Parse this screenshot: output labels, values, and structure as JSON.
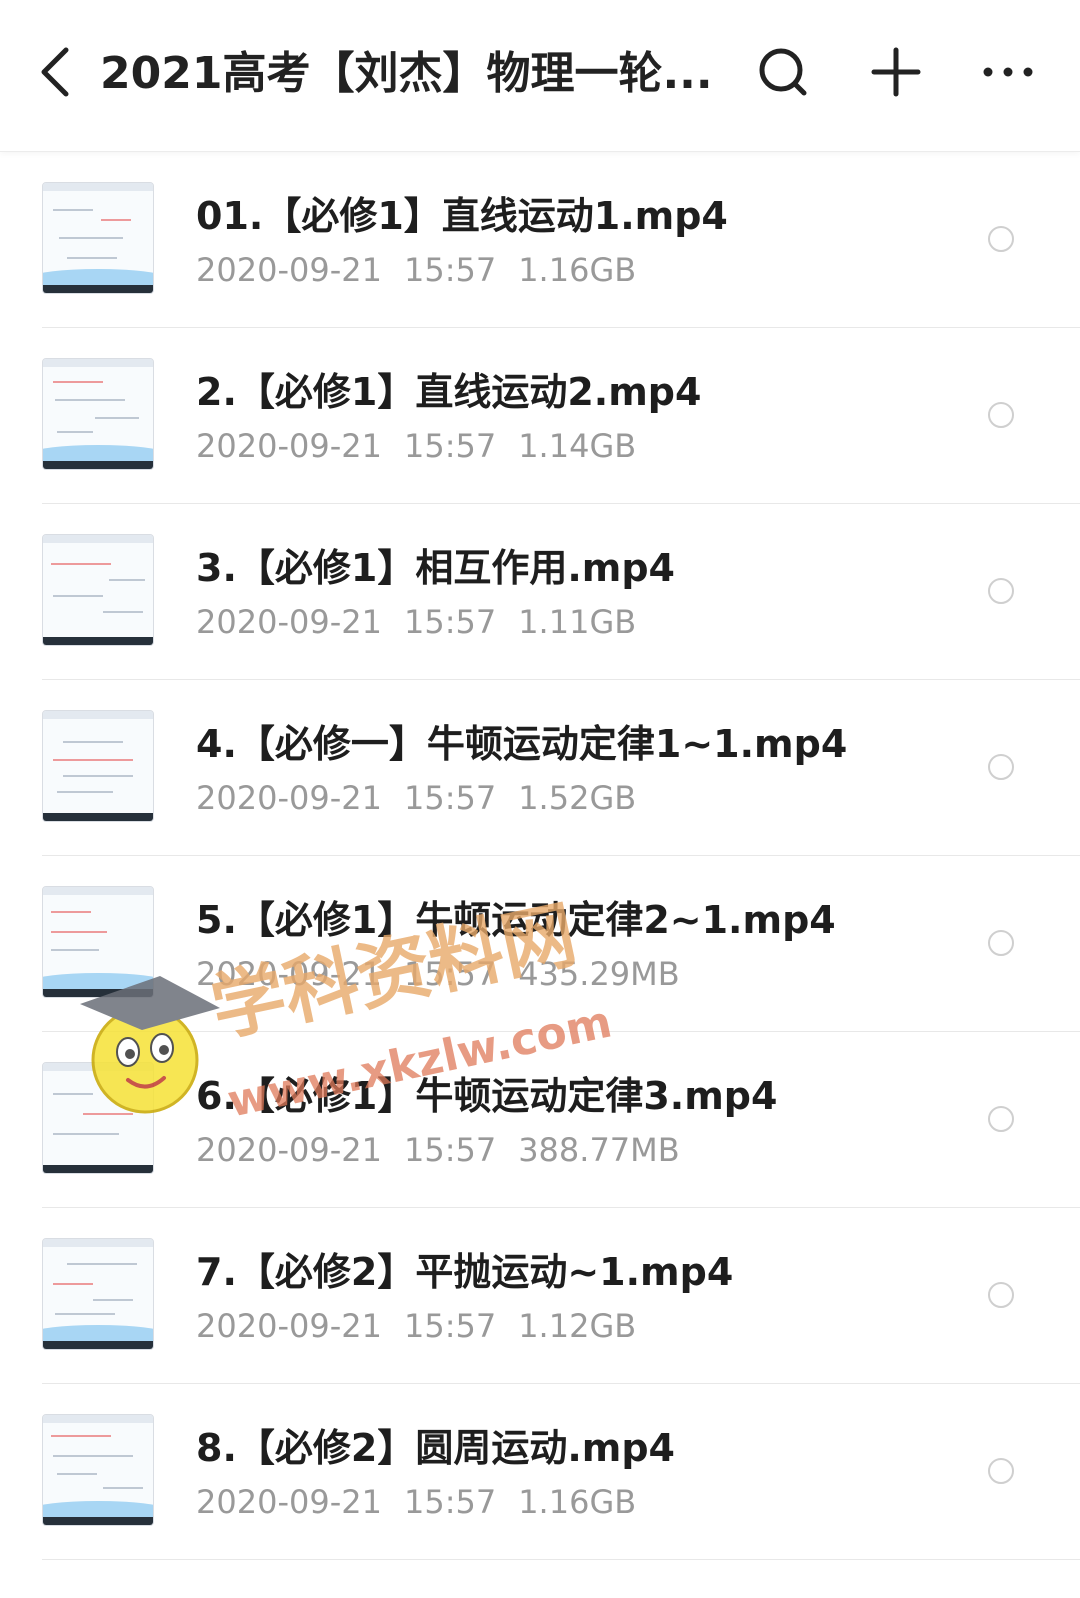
{
  "header": {
    "title": "2021高考【刘杰】物理一轮...",
    "icons": {
      "back": "back-arrow-icon",
      "search": "search-icon",
      "add": "plus-icon",
      "more": "more-icon"
    }
  },
  "files": [
    {
      "name": "01.【必修1】直线运动1.mp4",
      "date": "2020-09-21",
      "time": "15:57",
      "size": "1.16GB"
    },
    {
      "name": "2.【必修1】直线运动2.mp4",
      "date": "2020-09-21",
      "time": "15:57",
      "size": "1.14GB"
    },
    {
      "name": "3.【必修1】相互作用.mp4",
      "date": "2020-09-21",
      "time": "15:57",
      "size": "1.11GB"
    },
    {
      "name": "4.【必修一】牛顿运动定律1~1.mp4",
      "date": "2020-09-21",
      "time": "15:57",
      "size": "1.52GB"
    },
    {
      "name": "5.【必修1】牛顿运动定律2~1.mp4",
      "date": "2020-09-21",
      "time": "15:57",
      "size": "435.29MB"
    },
    {
      "name": "6.【必修1】牛顿运动定律3.mp4",
      "date": "2020-09-21",
      "time": "15:57",
      "size": "388.77MB"
    },
    {
      "name": "7.【必修2】平抛运动~1.mp4",
      "date": "2020-09-21",
      "time": "15:57",
      "size": "1.12GB"
    },
    {
      "name": "8.【必修2】圆周运动.mp4",
      "date": "2020-09-21",
      "time": "15:57",
      "size": "1.16GB"
    }
  ],
  "watermark": {
    "text": "学科资料网",
    "url": "www.xkzlw.com"
  },
  "colors": {
    "title": "#222222",
    "filename": "#1e1e1e",
    "meta": "#999999",
    "separator": "#e8e8e8"
  }
}
